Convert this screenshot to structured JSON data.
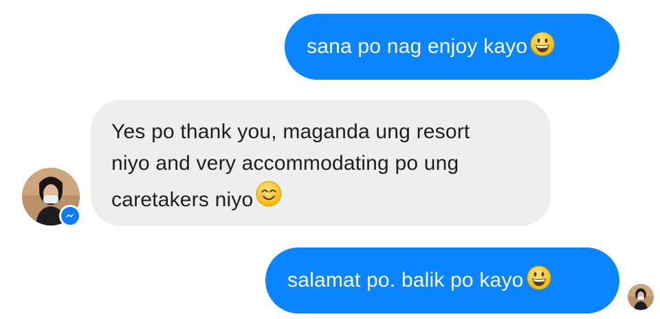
{
  "conversation": {
    "messages": [
      {
        "direction": "outgoing",
        "text": "sana po nag enjoy kayo",
        "emoji": "grinning-face"
      },
      {
        "direction": "incoming",
        "lines": [
          "Yes po thank you, maganda ung resort",
          "niyo and very accommodating po ung",
          "caretakers niyo"
        ],
        "emoji": "smiling-face-with-smiling-eyes"
      },
      {
        "direction": "outgoing",
        "text": "salamat po. balik po kayo",
        "emoji": "grinning-face"
      }
    ]
  },
  "colors": {
    "outgoing_bubble": "#0a84ff",
    "incoming_bubble": "#eeeeef",
    "messenger_badge": "#0a7cff"
  },
  "icons": {
    "contact_avatar": "contact-avatar",
    "messenger_badge": "messenger-icon",
    "read_receipt": "read-receipt-avatar"
  }
}
